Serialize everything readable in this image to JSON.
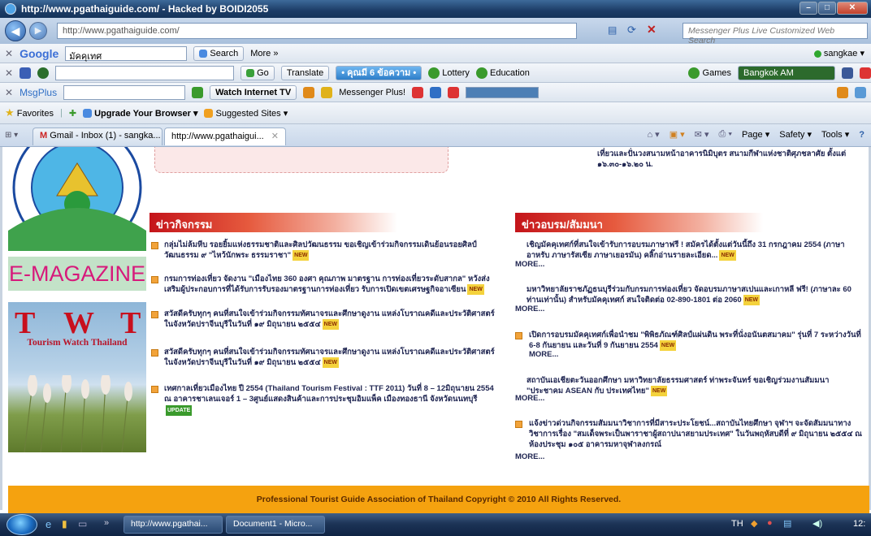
{
  "window": {
    "title": "http://www.pgathaiguide.com/ - Hacked by BOIDI2055"
  },
  "address_bar": {
    "url": "http://www.pgathaiguide.com/",
    "search_placeholder": "Messenger Plus Live Customized Web Search"
  },
  "google_toolbar": {
    "brand": "Google",
    "query": "มัคคุเทศ",
    "search_label": "Search",
    "more_label": "More »",
    "user": "sangkae"
  },
  "toolbar2": {
    "go_label": "Go",
    "translate_label": "Translate",
    "notice_label": "• คุณมี 6 ข้อความ •",
    "lottery_label": "Lottery",
    "education_label": "Education",
    "games_label": "Games",
    "weather_label": "Bangkok AM"
  },
  "toolbar3": {
    "msgplus_label": "MsgPlus",
    "watch_tv_label": "Watch Internet TV",
    "messenger_label": "Messenger Plus!"
  },
  "favorites_bar": {
    "favorites_label": "Favorites",
    "upgrade_label": "Upgrade Your Browser",
    "suggested_label": "Suggested Sites"
  },
  "tabs": [
    {
      "label": "Gmail - Inbox (1) - sangka..."
    },
    {
      "label": "http://www.pgathaigui..."
    }
  ],
  "command_bar": {
    "page_label": "Page",
    "safety_label": "Safety",
    "tools_label": "Tools"
  },
  "sidebar": {
    "emagazine_label": "E-MAGAZINE",
    "twt_letters": [
      "T",
      "W",
      "T"
    ],
    "twt_subtitle": "Tourism Watch Thailand"
  },
  "top_right_text": "เที่ยวและปั่นวงสนามหน้าอาคารนิมิบุตร สนามกีฬาแห่งชาติศุภชลาศัย ตั้งแต่ ๑๖.๓๐-๑๖.๒๐ น.",
  "activities": {
    "title": "ข่าวกิจกรรม",
    "items": [
      {
        "text": "กลุ่มไม่ล้มหีบ รอยยิ้มแห่งธรรมชาติและศิลปวัฒนธรรม ขอเชิญเข้าร่วมกิจกรรมเดินย้อนรอยศิลป์ วัฒนธรรม ๙ \"ไหว้นักพระ ธรรมราชา\"",
        "badge": "NEW"
      },
      {
        "text": "กรมการท่องเที่ยว จัดงาน \"เมืองไทย 360 องศา คุณภาพ มาตรฐาน การท่องเที่ยวระดับสากล\" หวังส่งเสริมผู้ประกอบการที่ได้รับการรับรองมาตรฐานการท่องเที่ยว รับการเปิดเขตเศรษฐกิจอาเซียน",
        "badge": "NEW"
      },
      {
        "text": "สวัสดีครับทุกๆ คนที่สนใจเข้าร่วมกิจกรรมทัศนาจรและศึกษาดูงาน แหล่งโบราณคดีและประวัติศาสตร์ ในจังหวัดปราจีนบุรีในวันที่ ๑๙ มิถุนายน ๒๕๕๔",
        "badge": "NEW"
      },
      {
        "text": "สวัสดีครับทุกๆ คนที่สนใจเข้าร่วมกิจกรรมทัศนาจรและศึกษาดูงาน แหล่งโบราณคดีและประวัติศาสตร์ ในจังหวัดปราจีนบุรีในวันที่ ๑๙ มิถุนายน ๒๕๕๔",
        "badge": "NEW"
      },
      {
        "text": "เทศกาลเที่ยวเมืองไทย ปี 2554 (Thailand Tourism Festival : TTF 2011) วันที่ 8 – 12มิถุนายน 2554 ณ อาคารชาเลนเจอร์ 1 – 3ศูนย์แสดงสินค้าและการประชุมอิมแพ็ค เมืองทองธานี จังหวัดนนทบุรี",
        "badge": "UPDATE"
      }
    ]
  },
  "training": {
    "title": "ข่าวอบรม/สัมมนา",
    "more_label": "MORE...",
    "items": [
      {
        "text": "เชิญมัคคุเทศก์ที่สนใจเข้ารับการอบรมภาษาฟรี ! สมัครได้ตั้งแต่วันนี้ถึง 31 กรกฎาคม 2554 (ภาษาอาหรับ ภาษารัสเซีย ภาษาเยอรมัน) คลิ๊กอ่านรายละเอียด...",
        "badge": "NEW"
      },
      {
        "text": "มหาวิทยาลัยราชภัฏธนบุรีร่วมกับกรมการท่องเที่ยว จัดอบรมภาษาสเปนและเกาหลี ฟรี! (ภาษาละ 60 ท่านเท่านั้น) สำหรับมัคคุเทศก์ สนใจติดต่อ 02-890-1801 ต่อ 2060",
        "badge": "NEW"
      },
      {
        "text": "เปิดการอบรมมัคคุเทศก์เพื่อนำชม \"พิพิธภัณฑ์ศิลป์แผ่นดิน พระที่นั่งอนันตสมาคม\" รุ่นที่ 7 ระหว่างวันที่ 6-8 กันยายน และวันที่ 9 กันยายน 2554",
        "badge": "NEW"
      },
      {
        "text": "สถาบันเอเชียตะวันออกศึกษา มหาวิทยาลัยธรรมศาสตร์ ท่าพระจันทร์ ขอเชิญร่วมงานสัมมนา \"ประชาคม ASEAN กับ ประเทศไทย\"",
        "badge": "NEW"
      },
      {
        "text": "แจ้งข่าวด่วนกิจกรรมสัมมนาวิชาการที่มีสาระประโยชน์...สถาบันไทยศึกษา จุฬาฯ จะจัดสัมมนาทางวิชาการเรื่อง \"สมเด็จพระเป็นพาราชาผู้สถาปนาสยามประเทศ\" ในวันพฤหัสบดีที่ ๙ มิถุนายน ๒๕๕๔ ณ ห้องประชุม ๑๐๕ อาคารมหาจุฬาลงกรณ์",
        "badge": ""
      }
    ]
  },
  "footer": {
    "text": "Professional Tourist Guide Association of Thailand Copyright © 2010 All Rights Reserved."
  },
  "taskbar": {
    "items": [
      "http://www.pgathai...",
      "Document1 - Micro..."
    ],
    "lang": "TH",
    "clock": "12:"
  }
}
